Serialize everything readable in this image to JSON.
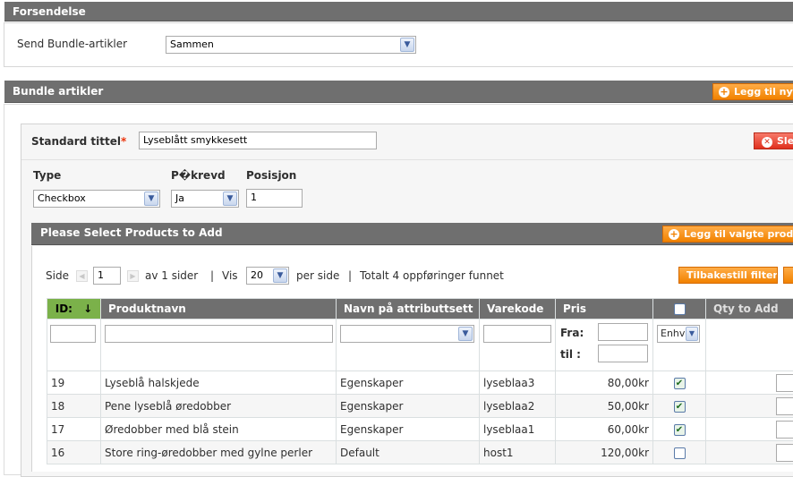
{
  "shipment": {
    "header": "Forsendelse",
    "label": "Send Bundle-artikler",
    "selected": "Sammen"
  },
  "bundle": {
    "header": "Bundle artikler",
    "add_new_label": "Legg til nytt",
    "title_label": "Standard tittel",
    "required_mark": "*",
    "title_value": "Lyseblått smykkesett",
    "delete_label": "Slett",
    "type_label": "Type",
    "required_label": "P�krevd",
    "position_label": "Posisjon",
    "type_value": "Checkbox",
    "required_value": "Ja",
    "position_value": "1"
  },
  "products": {
    "header": "Please Select Products to Add",
    "add_selected_label": "Legg til valgte produkter",
    "pager": {
      "page_label": "Side",
      "page_value": "1",
      "of_pages": "av 1 sider",
      "sep1": "|",
      "show_label": "Vis",
      "per_page_value": "20",
      "per_page_label": "per side",
      "sep2": "|",
      "total": "Totalt 4 oppføringer funnet"
    },
    "reset_filter_label": "Tilbakestill filter",
    "columns": {
      "id": "ID:",
      "name": "Produktnavn",
      "attrset": "Navn på attributtsett",
      "sku": "Varekode",
      "price": "Pris",
      "qty": "Qty to Add"
    },
    "sort_arrow": "↓",
    "filter": {
      "from_label": "Fra:",
      "to_label": "til :",
      "select_any": "Enhver"
    },
    "rows": [
      {
        "id": "19",
        "name": "Lyseblå halskjede",
        "attrset": "Egenskaper",
        "sku": "lyseblaa3",
        "price": "80,00kr",
        "checked": true
      },
      {
        "id": "18",
        "name": "Pene lyseblå øredobber",
        "attrset": "Egenskaper",
        "sku": "lyseblaa2",
        "price": "50,00kr",
        "checked": true
      },
      {
        "id": "17",
        "name": "Øredobber med blå stein",
        "attrset": "Egenskaper",
        "sku": "lyseblaa1",
        "price": "60,00kr",
        "checked": true
      },
      {
        "id": "16",
        "name": "Store ring-øredobber med gylne perler",
        "attrset": "Default",
        "sku": "host1",
        "price": "120,00kr",
        "checked": false
      }
    ]
  }
}
